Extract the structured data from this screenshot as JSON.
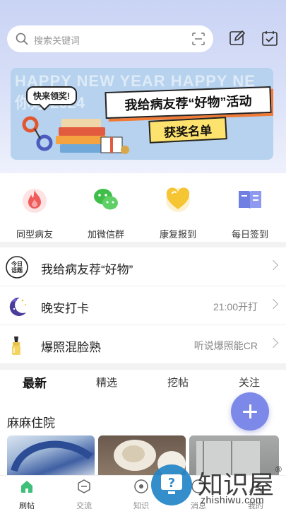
{
  "search": {
    "placeholder": "搜索关键词"
  },
  "header": {
    "icons": [
      "edit-icon",
      "calendar-check-icon"
    ]
  },
  "banner": {
    "ghost_line1": "HAPPY NEW YEAR HAPPY NE",
    "ghost_line2": "你好 2024",
    "tag": "快来领奖!",
    "headline": "我给病友荐“好物”活动",
    "award": "获奖名单"
  },
  "quick_actions": [
    {
      "label": "同型病友",
      "icon": "flame-icon",
      "color": "#ef5a5a"
    },
    {
      "label": "加微信群",
      "icon": "wechat-icon",
      "color": "#3fbf4a"
    },
    {
      "label": "康复报到",
      "icon": "heart-icon",
      "color": "#f5c533"
    },
    {
      "label": "每日签到",
      "icon": "book-icon",
      "color": "#6f7fe2"
    }
  ],
  "rows": [
    {
      "icon": "today-topic-icon",
      "title": "我给病友荐“好物”",
      "meta": ""
    },
    {
      "icon": "moon-icon",
      "title": "晚安打卡",
      "meta": "21:00开打"
    },
    {
      "icon": "lipstick-icon",
      "title": "爆照混脸熟",
      "meta": "听说爆照能CR"
    }
  ],
  "tabs": [
    "最新",
    "精选",
    "挖帖",
    "关注"
  ],
  "section_title": "麻麻住院",
  "nav": [
    {
      "label": "刷帖",
      "icon": "home-icon",
      "active": true
    },
    {
      "label": "交流",
      "icon": "chat-icon",
      "active": false
    },
    {
      "label": "知识",
      "icon": "knowledge-icon",
      "active": false
    },
    {
      "label": "消息",
      "icon": "message-icon",
      "active": false
    },
    {
      "label": "我的",
      "icon": "profile-icon",
      "active": false
    }
  ],
  "watermark": {
    "text": "知识屋",
    "sub": "zhishiwu.com",
    "registered": "®"
  },
  "colors": {
    "accent": "#7c89e8",
    "header_bg": "#c9d3f4"
  }
}
